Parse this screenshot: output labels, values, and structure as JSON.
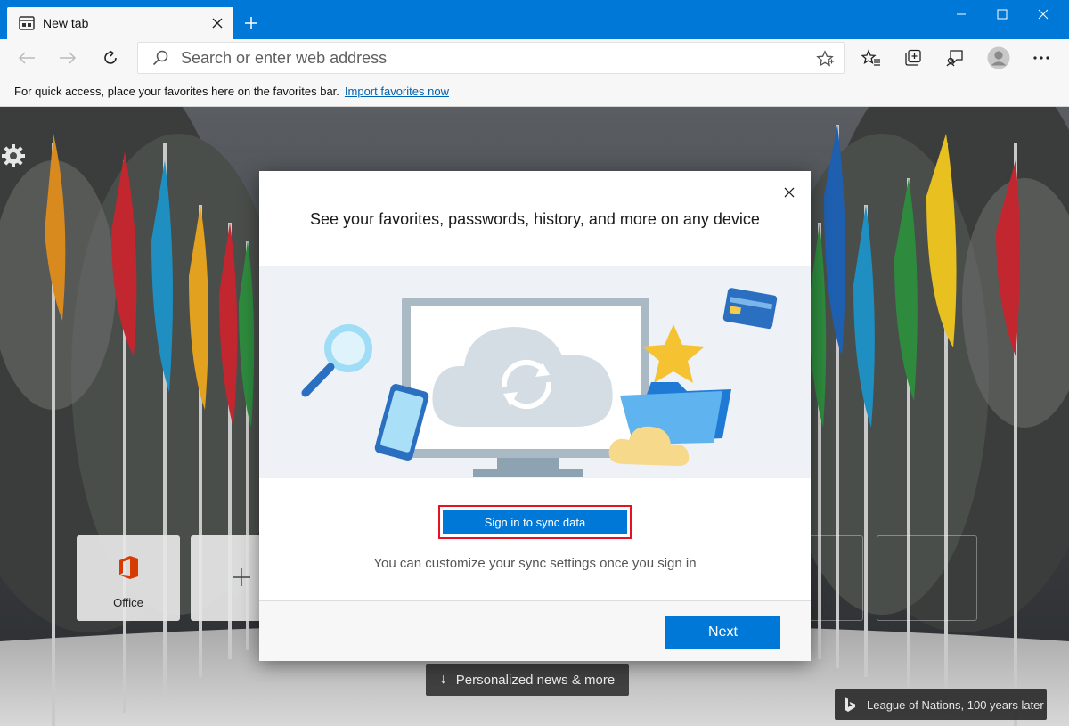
{
  "window": {
    "tab_title": "New tab",
    "tab_favicon": "newtab-icon",
    "tab_close": "close-icon",
    "new_tab": "plus-icon",
    "controls": [
      "minimize-icon",
      "maximize-icon",
      "close-icon"
    ],
    "accent_color": "#0078d7"
  },
  "toolbar": {
    "address_placeholder": "Search or enter web address",
    "buttons": [
      "back-icon",
      "forward-icon",
      "refresh-icon",
      "favorites-icon",
      "collections-icon",
      "feedback-icon",
      "profile-icon",
      "more-icon"
    ]
  },
  "favorites_bar": {
    "message": "For quick access, place your favorites here on the favorites bar.",
    "link": "Import favorites now"
  },
  "newtab": {
    "tiles": [
      {
        "label": "Office",
        "icon": "office-icon"
      },
      {
        "label": "",
        "icon": "plus-icon"
      }
    ],
    "news_button": "Personalized news & more",
    "image_credit": "League of Nations, 100 years later"
  },
  "dialog": {
    "title": "See your favorites, passwords, history, and more on any device",
    "sync_button": "Sign in to sync data",
    "subtitle": "You can customize your sync settings once you sign in",
    "next_button": "Next",
    "highlight_color": "#e81123"
  }
}
